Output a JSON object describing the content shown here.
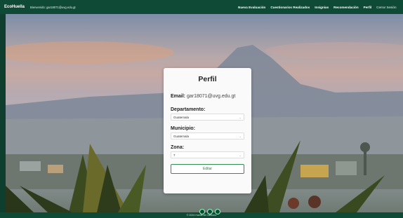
{
  "navbar": {
    "brand": "EcoHuella",
    "welcome": "Bienvenido: gar18071@uvg.edu.gt",
    "links": [
      "Nueva Evaluación",
      "Cuestionarios Realizados",
      "Insignias",
      "Recomendación",
      "Perfil",
      "Cerrar Sesión"
    ]
  },
  "profile": {
    "title": "Perfil",
    "email_label": "Email:",
    "email_value": "gar18071@uvg.edu.gt",
    "departamento_label": "Departamento:",
    "departamento_value": "Guatemala",
    "municipio_label": "Municipio:",
    "municipio_value": "Guatemala",
    "zona_label": "Zona:",
    "zona_value": "7",
    "edit_button": "Editar"
  },
  "footer": {
    "text": "© 2024 Huella de Carbono"
  }
}
